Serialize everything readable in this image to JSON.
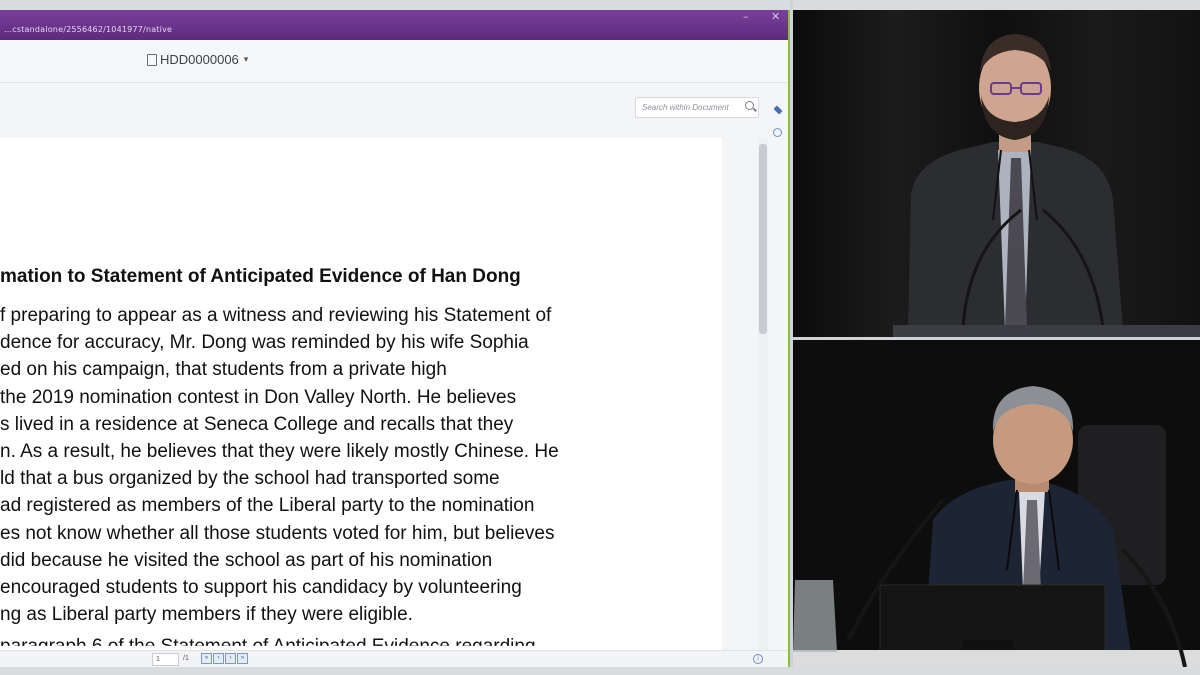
{
  "titlebar": {
    "url": "...cstandalone/2556462/1041977/native",
    "minimize_glyph": "–",
    "close_glyph": "✕"
  },
  "toolbar": {
    "document_id": "HDD0000006",
    "caret": "▾",
    "search_placeholder": "Search within Document"
  },
  "document": {
    "heading": "mation to Statement of Anticipated Evidence of Han Dong",
    "lines": [
      "f preparing to appear as a witness and reviewing his Statement of",
      "dence for accuracy, Mr. Dong was reminded by his wife Sophia",
      "ed on his campaign, that students from a private high",
      "the 2019 nomination contest in Don Valley North. He believes",
      "s lived in a residence at Seneca College and recalls that they",
      "n. As a result, he believes that they were likely mostly Chinese. He",
      "ld that a bus organized by the school had transported some",
      "ad registered as members of the Liberal party to the nomination",
      "es not know whether all those students voted for him, but believes",
      "did because he visited the school as part of his nomination",
      "encouraged students to support his candidacy by volunteering",
      "ng as Liberal party members if they were eligible."
    ],
    "next_line": "paragraph 6 of the Statement of Anticipated Evidence regarding"
  },
  "statusbar": {
    "page_current": "1",
    "page_total": "/1",
    "nav_buttons": [
      "«",
      "‹",
      "›",
      "»"
    ],
    "info_glyph": "i"
  },
  "scrollbar": {
    "down_arrow": "▾"
  },
  "video": {
    "top_feed": "speaker standing at podium",
    "bottom_feed": "witness seated at table with microphone"
  }
}
